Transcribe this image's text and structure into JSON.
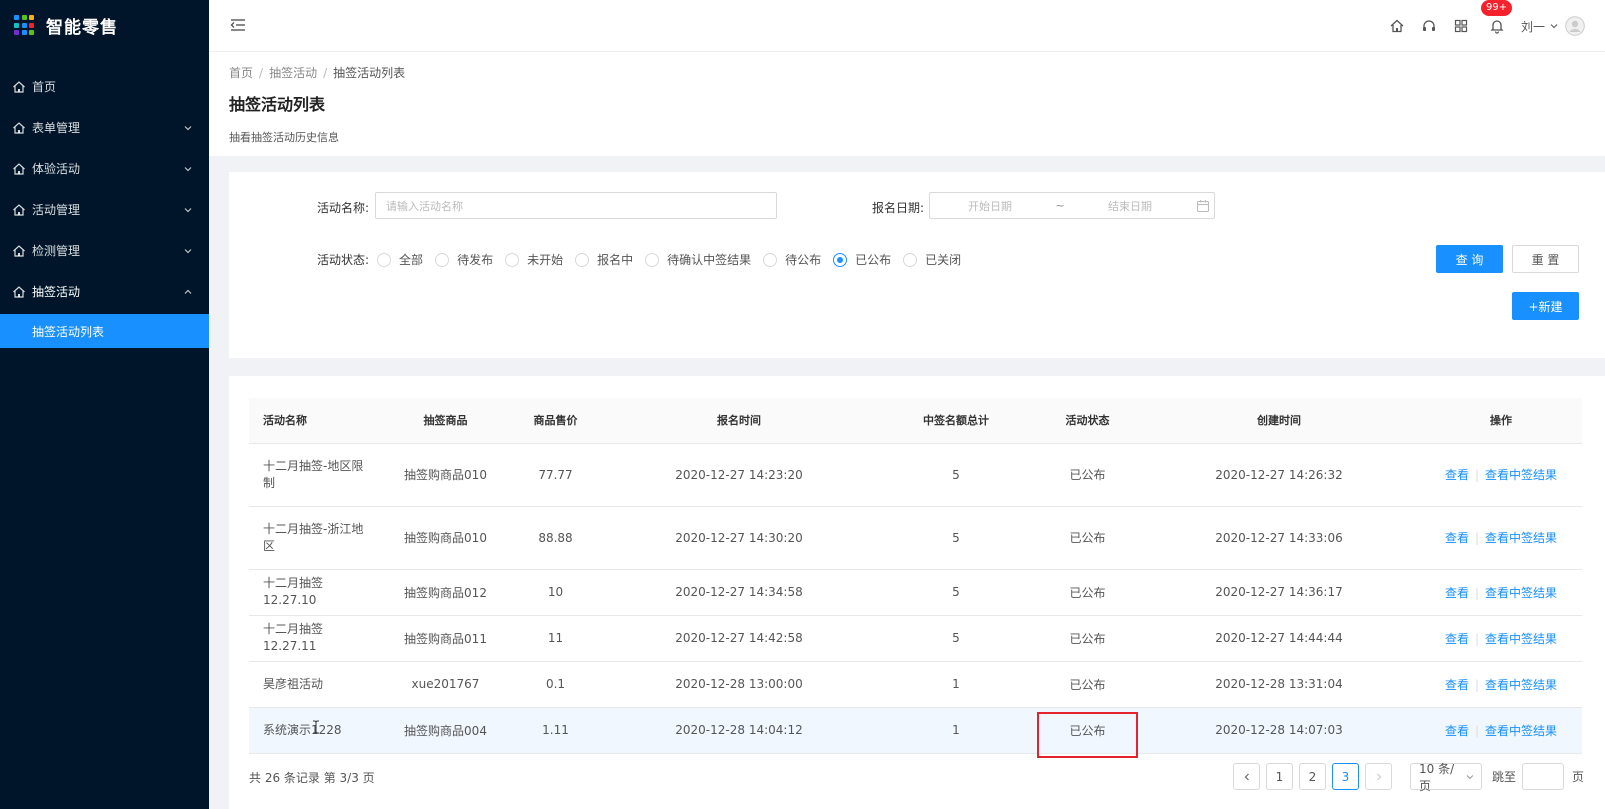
{
  "app": {
    "title": "智能零售"
  },
  "sidebar": {
    "items": [
      {
        "label": "首页",
        "has_arrow": false
      },
      {
        "label": "表单管理",
        "has_arrow": true
      },
      {
        "label": "体验活动",
        "has_arrow": true
      },
      {
        "label": "活动管理",
        "has_arrow": true
      },
      {
        "label": "检测管理",
        "has_arrow": true
      },
      {
        "label": "抽签活动",
        "has_arrow": true,
        "open": true
      }
    ],
    "active_sub": "抽签活动列表"
  },
  "header": {
    "badge": "99+",
    "user_name": "刘一"
  },
  "breadcrumb": [
    "首页",
    "抽签活动",
    "抽签活动列表"
  ],
  "page": {
    "title": "抽签活动列表",
    "description": "抽看抽签活动历史信息"
  },
  "filter": {
    "name_label": "活动名称:",
    "name_placeholder": "请输入活动名称",
    "date_label": "报名日期:",
    "date_start_placeholder": "开始日期",
    "date_sep": "~",
    "date_end_placeholder": "结束日期",
    "status_label": "活动状态:",
    "status_options": [
      "全部",
      "待发布",
      "未开始",
      "报名中",
      "待确认中签结果",
      "待公布",
      "已公布",
      "已关闭"
    ],
    "status_selected": "已公布",
    "query_label": "查 询",
    "reset_label": "重 置",
    "new_label": "+新建"
  },
  "table": {
    "columns": [
      "活动名称",
      "抽签商品",
      "商品售价",
      "报名时间",
      "中签名额总计",
      "活动状态",
      "创建时间",
      "操作"
    ],
    "rows": [
      {
        "name": "十二月抽签-地区限制",
        "product": "抽签购商品010",
        "price": "77.77",
        "signup_time": "2020-12-27 14:23:20",
        "quota": "5",
        "status": "已公布",
        "created": "2020-12-27 14:26:32"
      },
      {
        "name": "十二月抽签-浙江地区",
        "product": "抽签购商品010",
        "price": "88.88",
        "signup_time": "2020-12-27 14:30:20",
        "quota": "5",
        "status": "已公布",
        "created": "2020-12-27 14:33:06"
      },
      {
        "name": "十二月抽签12.27.10",
        "product": "抽签购商品012",
        "price": "10",
        "signup_time": "2020-12-27 14:34:58",
        "quota": "5",
        "status": "已公布",
        "created": "2020-12-27 14:36:17"
      },
      {
        "name": "十二月抽签12.27.11",
        "product": "抽签购商品011",
        "price": "11",
        "signup_time": "2020-12-27 14:42:58",
        "quota": "5",
        "status": "已公布",
        "created": "2020-12-27 14:44:44"
      },
      {
        "name": "昊彦祖活动",
        "product": "xue201767",
        "price": "0.1",
        "signup_time": "2020-12-28 13:00:00",
        "quota": "1",
        "status": "已公布",
        "created": "2020-12-28 13:31:04"
      },
      {
        "name": "系统演示1228",
        "product": "抽签购商品004",
        "price": "1.11",
        "signup_time": "2020-12-28 14:04:12",
        "quota": "1",
        "status": "已公布",
        "created": "2020-12-28 14:07:03"
      }
    ],
    "op_view": "查看",
    "op_result": "查看中签结果"
  },
  "pagination": {
    "total_text": "共 26 条记录 第 3/3 页",
    "pages": [
      "1",
      "2",
      "3"
    ],
    "current": "3",
    "page_size": "10 条/页",
    "jump_label": "跳至",
    "jump_suffix": "页"
  },
  "colors": {
    "primary": "#1890ff",
    "sidebar_bg": "#001529",
    "highlight_box": "#e5232d",
    "badge": "#f5222d"
  }
}
